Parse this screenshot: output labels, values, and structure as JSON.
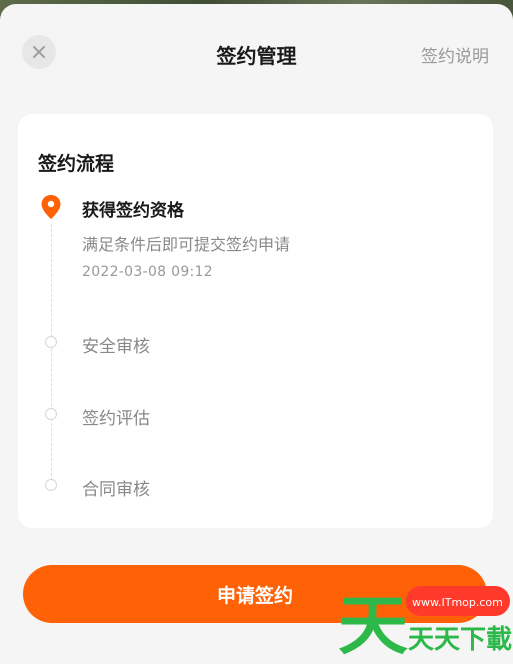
{
  "header": {
    "title": "签约管理",
    "help_label": "签约说明"
  },
  "card": {
    "title": "签约流程",
    "steps": [
      {
        "title": "获得签约资格",
        "desc": "满足条件后即可提交签约申请",
        "time": "2022-03-08 09:12",
        "active": true
      },
      {
        "title": "安全审核",
        "active": false
      },
      {
        "title": "签约评估",
        "active": false
      },
      {
        "title": "合同审核",
        "active": false
      }
    ]
  },
  "footer": {
    "apply_label": "申请签约"
  },
  "watermark": {
    "site": "www.ITmop.com",
    "text": "天天下載"
  },
  "colors": {
    "accent": "#ff6106",
    "watermark_green": "#2db84a"
  }
}
